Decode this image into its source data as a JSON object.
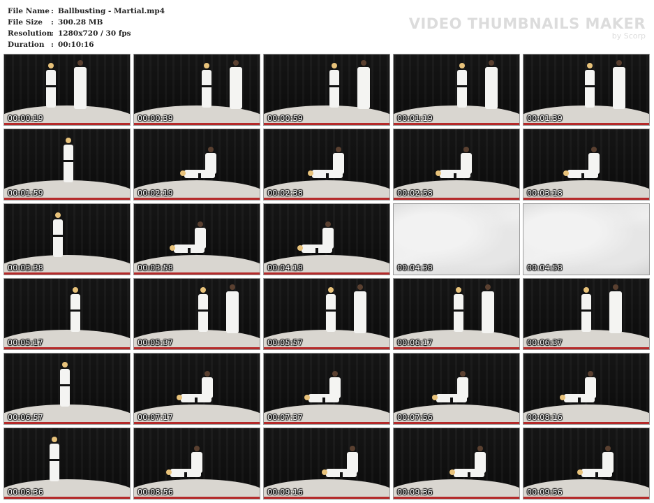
{
  "file_info": [
    {
      "label": "File Name",
      "sep": ":",
      "value": "Ballbusting - Martial.mp4"
    },
    {
      "label": "File Size",
      "sep": ":",
      "value": "300.28 MB"
    },
    {
      "label": "Resolution",
      "sep": ":",
      "value": "1280x720 / 30 fps"
    },
    {
      "label": "Duration",
      "sep": ":",
      "value": "00:10:16"
    }
  ],
  "brand": {
    "title": "VIDEO THUMBNAILS MAKER",
    "subtitle": "by Scorp",
    "color": "#dcdcdc"
  },
  "thumbnails": [
    {
      "time": "00:00:19"
    },
    {
      "time": "00:00:39"
    },
    {
      "time": "00:00:59"
    },
    {
      "time": "00:01:19"
    },
    {
      "time": "00:01:39"
    },
    {
      "time": "00:01:59"
    },
    {
      "time": "00:02:19"
    },
    {
      "time": "00:02:38"
    },
    {
      "time": "00:02:58"
    },
    {
      "time": "00:03:18"
    },
    {
      "time": "00:03:38"
    },
    {
      "time": "00:03:58"
    },
    {
      "time": "00:04:18"
    },
    {
      "time": "00:04:38"
    },
    {
      "time": "00:04:58"
    },
    {
      "time": "00:05:17"
    },
    {
      "time": "00:05:37"
    },
    {
      "time": "00:05:57"
    },
    {
      "time": "00:06:17"
    },
    {
      "time": "00:06:37"
    },
    {
      "time": "00:06:57"
    },
    {
      "time": "00:07:17"
    },
    {
      "time": "00:07:37"
    },
    {
      "time": "00:07:56"
    },
    {
      "time": "00:08:16"
    },
    {
      "time": "00:08:36"
    },
    {
      "time": "00:08:56"
    },
    {
      "time": "00:09:16"
    },
    {
      "time": "00:09:36"
    },
    {
      "time": "00:09:56"
    }
  ]
}
